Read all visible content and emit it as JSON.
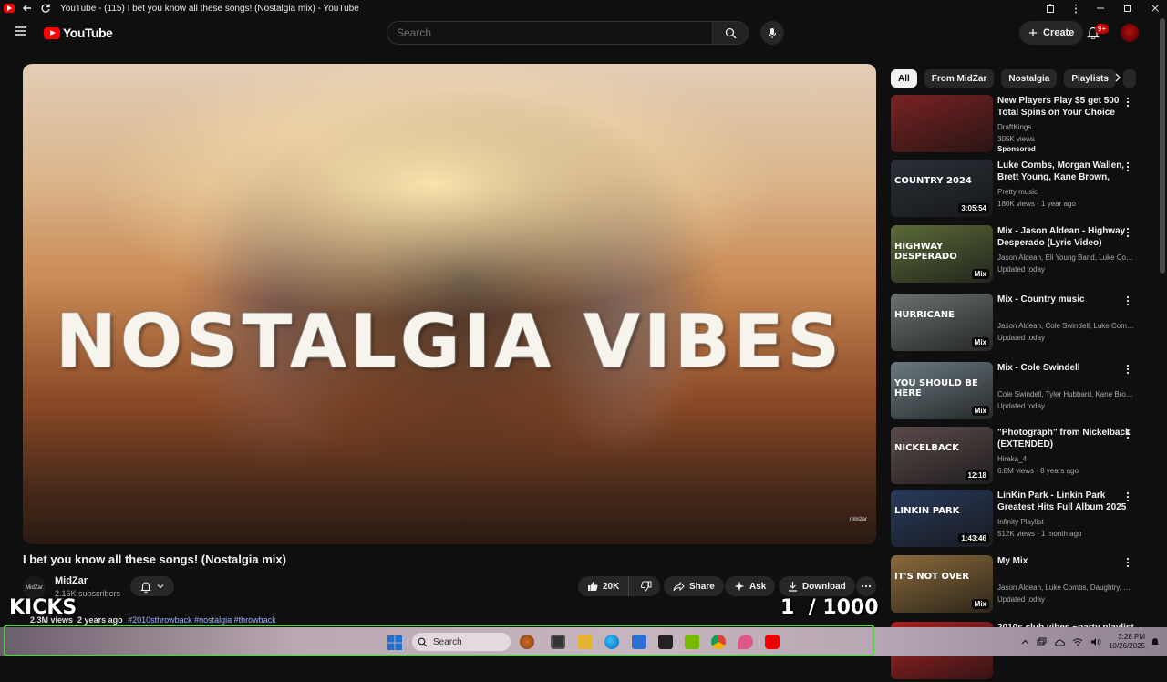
{
  "window": {
    "title": "YouTube - (115) I bet you know all these songs! (Nostalgia mix) - YouTube"
  },
  "header": {
    "logo_text": "YouTube",
    "search_placeholder": "Search",
    "create_label": "Create",
    "notification_count": "9+"
  },
  "player": {
    "overlay_title": "NOSTALGIA VIBES",
    "watermark": "nkkizar"
  },
  "video": {
    "title": "I bet you know all these songs! (Nostalgia mix)",
    "channel_name": "MidZar",
    "channel_avatar_text": "MidZar",
    "subscribers": "2.16K subscribers",
    "likes": "20K",
    "share_label": "Share",
    "ask_label": "Ask",
    "download_label": "Download",
    "views": "2.3M views",
    "age": "2 years ago",
    "tags": "#2010sthrowback #nostalgia #throwback"
  },
  "overlays": {
    "left_caption": "KICKS",
    "counter": "1  / 1000"
  },
  "chips": [
    "All",
    "From MidZar",
    "Nostalgia",
    "Playlists"
  ],
  "recommendations": [
    {
      "title": "New Players Play $5 get 500 Total Spins on Your Choice Of...",
      "line1": "DraftKings",
      "line2": "305K views",
      "line3": "Sponsored",
      "duration": "",
      "thumb_text": "",
      "thumb_color": "#7a2222"
    },
    {
      "title": "Luke Combs, Morgan Wallen, Brett Young, Kane Brown, Jas...",
      "line1": "Pretty music",
      "line2": "180K views · 1 year ago",
      "line3": "",
      "duration": "3:05:54",
      "thumb_text": "COUNTRY 2024",
      "thumb_color": "#2a3038"
    },
    {
      "title": "Mix - Jason Aldean - Highway Desperado (Lyric Video)",
      "line1": "Jason Aldean, Eli Young Band, Luke Com...",
      "line2": "Updated today",
      "line3": "",
      "duration": "Mix",
      "thumb_text": "HIGHWAY DESPERADO",
      "thumb_color": "#5a6a3a"
    },
    {
      "title": "Mix - Country music",
      "line1": "Jason Aldean, Cole Swindell, Luke Comb...",
      "line2": "Updated today",
      "line3": "",
      "duration": "Mix",
      "thumb_text": "HURRICANE",
      "thumb_color": "#6a7070"
    },
    {
      "title": "Mix - Cole Swindell",
      "line1": "Cole Swindell, Tyler Hubbard, Kane Brow...",
      "line2": "Updated today",
      "line3": "",
      "duration": "Mix",
      "thumb_text": "YOU SHOULD BE HERE",
      "thumb_color": "#6a7a80"
    },
    {
      "title": "\"Photograph\" from Nickelback (EXTENDED)",
      "line1": "Hiraka_4",
      "line2": "6.8M views · 8 years ago",
      "line3": "",
      "duration": "12:18",
      "thumb_text": "NICKELBACK",
      "thumb_color": "#5a4a4a"
    },
    {
      "title": "LinKin Park - Linkin Park Greatest Hits Full Album 2025 ...",
      "line1": "Infinity Playlist",
      "line2": "512K views · 1 month ago",
      "line3": "",
      "duration": "1:43:46",
      "thumb_text": "LINKIN PARK",
      "thumb_color": "#2a3a5a"
    },
    {
      "title": "My Mix",
      "line1": "Jason Aldean, Luke Combs, Daughtry, an...",
      "line2": "Updated today",
      "line3": "",
      "duration": "Mix",
      "thumb_text": "IT'S NOT OVER",
      "thumb_color": "#8a6a3a"
    },
    {
      "title": "2010s club vibes ~party playlist",
      "line1": "",
      "line2": "",
      "line3": "",
      "duration": "",
      "thumb_text": "",
      "thumb_color": "#aa2222"
    }
  ],
  "taskbar": {
    "search_label": "Search",
    "time": "3:28 PM",
    "date": "10/26/2025"
  }
}
